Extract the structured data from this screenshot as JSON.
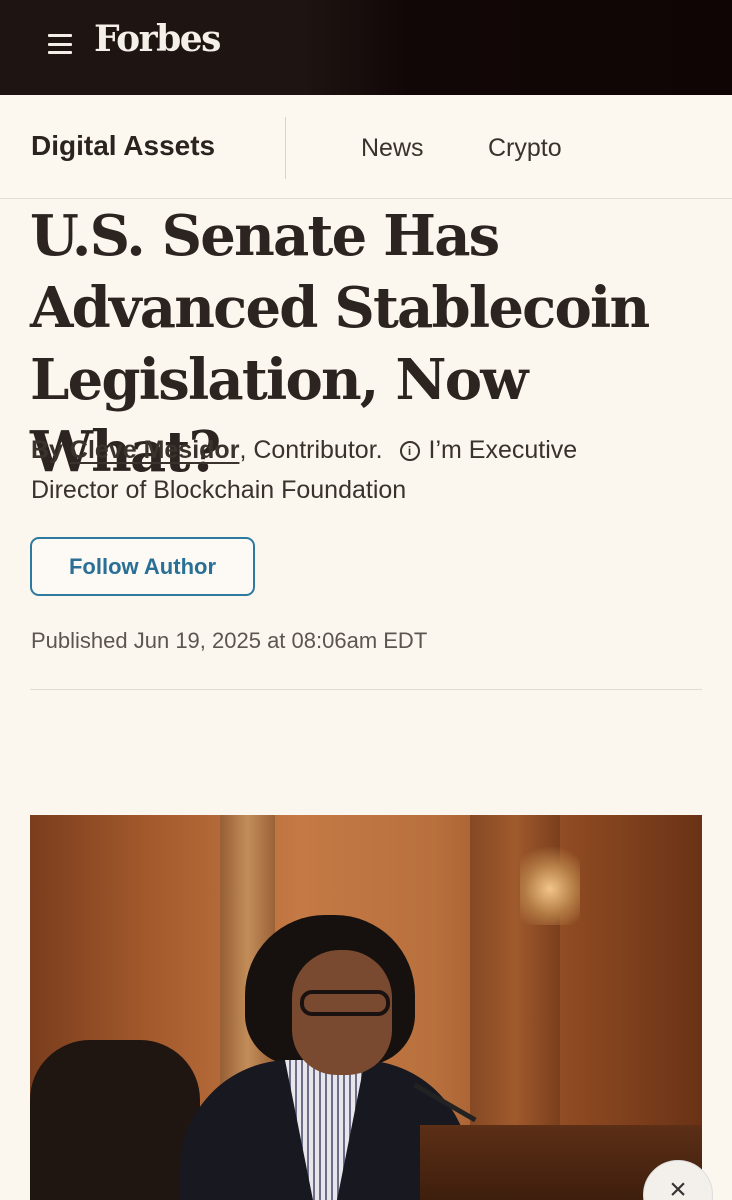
{
  "header": {
    "brand": "Forbes",
    "menu_icon": "hamburger-menu-icon"
  },
  "section_nav": {
    "title": "Digital Assets",
    "links": [
      "News",
      "Crypto"
    ]
  },
  "article": {
    "headline": "U.S. Senate Has Advanced Stablecoin Legislation, Now What?",
    "byline_prefix": "By",
    "author": "Cleve Mesidor",
    "author_suffix": ",",
    "role": "Contributor.",
    "bio": "I’m Executive Director of Blockchain Foundation",
    "info_icon": "info-icon",
    "follow_label": "Follow Author",
    "published": "Published Jun 19, 2025 at 08:06am EDT"
  },
  "overlay": {
    "close_label": "×"
  },
  "colors": {
    "topbar_bg": "#1e1512",
    "page_bg": "#fbf6ee",
    "follow_accent": "#2c7aa0"
  }
}
